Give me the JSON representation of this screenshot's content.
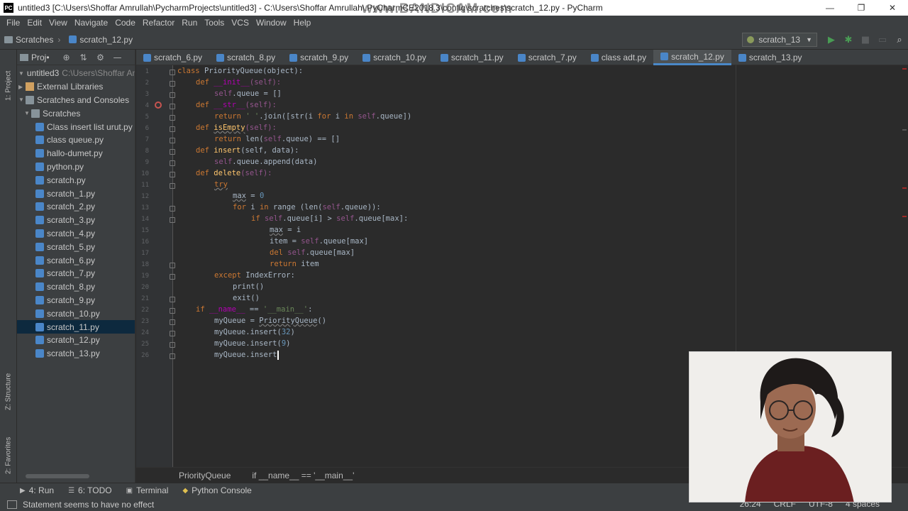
{
  "window": {
    "title": "untitled3 [C:\\Users\\Shoffar Amrullah\\PycharmProjects\\untitled3] - C:\\Users\\Shoffar Amrullah\\.PyCharmCE2018.3\\config\\scratches\\scratch_12.py - PyCharm",
    "watermark": "www.BANDICAM.com",
    "app_icon": "PC",
    "minimize": "—",
    "maximize": "❐",
    "close": "✕"
  },
  "menu": [
    "File",
    "Edit",
    "View",
    "Navigate",
    "Code",
    "Refactor",
    "Run",
    "Tools",
    "VCS",
    "Window",
    "Help"
  ],
  "navbar": {
    "crumbs": [
      "Scratches",
      "scratch_12.py"
    ],
    "run_config": "scratch_13"
  },
  "left_tabs": {
    "project": "1: Project",
    "structure": "Z: Structure",
    "favorites": "2: Favorites"
  },
  "project_panel": {
    "header": "Proj•",
    "root": {
      "label": "untitled3",
      "path": "C:\\Users\\Shoffar Amrullah"
    },
    "external_libraries": "External Libraries",
    "scratches_and_consoles": "Scratches and Consoles",
    "scratches_folder": "Scratches",
    "files": [
      "Class insert list urut.py",
      "class queue.py",
      "hallo-dumet.py",
      "python.py",
      "scratch.py",
      "scratch_1.py",
      "scratch_2.py",
      "scratch_3.py",
      "scratch_4.py",
      "scratch_5.py",
      "scratch_6.py",
      "scratch_7.py",
      "scratch_8.py",
      "scratch_9.py",
      "scratch_10.py",
      "scratch_11.py",
      "scratch_12.py",
      "scratch_13.py"
    ],
    "selected_file": "scratch_11.py"
  },
  "tabs": [
    "scratch_6.py",
    "scratch_8.py",
    "scratch_9.py",
    "scratch_10.py",
    "scratch_11.py",
    "scratch_7.py",
    "class adt.py",
    "scratch_12.py",
    "scratch_13.py"
  ],
  "active_tab": "scratch_12.py",
  "line_numbers": [
    "1",
    "2",
    "3",
    "4",
    "5",
    "6",
    "7",
    "8",
    "9",
    "10",
    "11",
    "12",
    "13",
    "14",
    "15",
    "16",
    "17",
    "18",
    "19",
    "20",
    "21",
    "22",
    "23",
    "24",
    "25",
    "26"
  ],
  "code": {
    "l1_class": "class ",
    "l1_name": "PriorityQueue",
    "l1_rest": "(object):",
    "l2_def": "def ",
    "l2_name": "__init__",
    "l2_args": "(self):",
    "l3_self": "self",
    "l3_rest": ".queue = []",
    "l4_def": "def ",
    "l4_name": "__str__",
    "l4_args": "(self):",
    "l5_return": "return ",
    "l5_str": "' '",
    "l5_mid": ".join([str(i ",
    "l5_for": "for ",
    "l5_i": "i ",
    "l5_in": "in ",
    "l5_self": "self",
    "l5_end": ".queue])",
    "l6_def": "def ",
    "l6_name": "isEmpty",
    "l6_args": "(self):",
    "l7_return": "return ",
    "l7_mid": "len(",
    "l7_self": "self",
    "l7_end": ".queue) == []",
    "l8_def": "def ",
    "l8_name": "insert",
    "l8_args": "(self, data):",
    "l9_self": "self",
    "l9_rest": ".queue.append(data)",
    "l10_def": "def ",
    "l10_name": "delete",
    "l10_args": "(self):",
    "l11_try": "try",
    "l12_max": "max",
    "l12_eq": " = ",
    "l12_zero": "0",
    "l13_for": "for ",
    "l13_i": "i ",
    "l13_in": "in ",
    "l13_range": "range ",
    "l13_len": "(len(",
    "l13_self": "self",
    "l13_end": ".queue)):",
    "l14_if": "if ",
    "l14_self": "self",
    "l14_mid": ".queue[i] > ",
    "l14_self2": "self",
    "l14_end": ".queue[max]:",
    "l15_max": "max",
    "l15_rest": " = i",
    "l16_item": "item = ",
    "l16_self": "self",
    "l16_end": ".queue[max]",
    "l17_del": "del ",
    "l17_self": "self",
    "l17_end": ".queue[max]",
    "l18_return": "return ",
    "l18_item": "item",
    "l19_except": "except ",
    "l19_err": "IndexError:",
    "l20_print": "print()",
    "l21_exit": "exit()",
    "l22_if": "if ",
    "l22_name": "__name__",
    "l22_eq": " == ",
    "l22_str": "'__main__'",
    "l22_colon": ":",
    "l23_var": "myQueue = ",
    "l23_cls": "PriorityQueue",
    "l23_end": "()",
    "l24_call": "myQueue.insert(",
    "l24_num": "32",
    "l24_end": ")",
    "l25_call": "myQueue.insert(",
    "l25_num": "9",
    "l25_end": ")",
    "l26_call": "myQueue.insert"
  },
  "breadcrumb": [
    "PriorityQueue",
    "if __name__ == '__main__'"
  ],
  "bottom_tools": [
    {
      "icon": "▶",
      "label": "4: Run"
    },
    {
      "icon": "☰",
      "label": "6: TODO"
    },
    {
      "icon": "▣",
      "label": "Terminal"
    },
    {
      "icon": "◆",
      "label": "Python Console"
    }
  ],
  "status": {
    "message": "Statement seems to have no effect",
    "position": "26:24",
    "line_sep": "CRLF",
    "encoding": "UTF-8",
    "indent": "4 spaces"
  },
  "colors": {
    "editor_bg": "#2b2b2b",
    "panel_bg": "#3c3f41",
    "keyword": "#cc7832",
    "function": "#ffc66d",
    "string": "#6a8759",
    "number": "#6897bb",
    "selection": "#0d293e",
    "accent": "#4a88c7"
  }
}
